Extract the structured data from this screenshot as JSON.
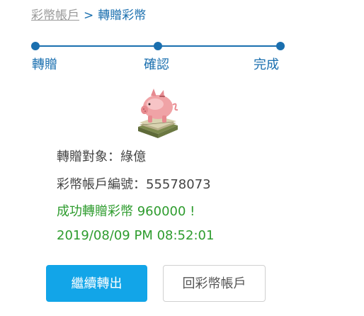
{
  "breadcrumb": {
    "parent_label": "彩幣帳戶",
    "separator": ">",
    "current_label": "轉贈彩幣"
  },
  "steps": [
    {
      "label": "轉贈"
    },
    {
      "label": "確認"
    },
    {
      "label": "完成"
    }
  ],
  "icon": {
    "name": "piggy-bank-icon"
  },
  "result": {
    "recipient": "轉贈對象：綠億",
    "account_number": "彩幣帳戶編號：55578073",
    "success_message": "成功轉贈彩幣 960000 !",
    "timestamp": "2019/08/09 PM 08:52:01"
  },
  "buttons": {
    "continue_label": "繼續轉出",
    "back_label": "回彩幣帳戶"
  },
  "colors": {
    "accent": "#1a6faf",
    "success": "#2e9c2e",
    "primary_button": "#12a5e8"
  }
}
